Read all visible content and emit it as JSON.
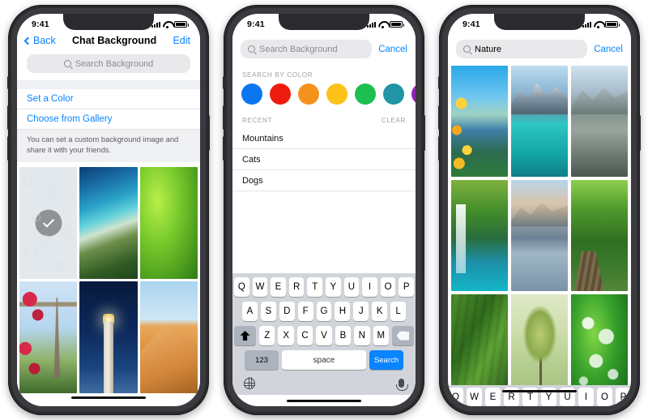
{
  "status_bar": {
    "time": "9:41",
    "icons": [
      "signal-icon",
      "wifi-icon",
      "battery-icon"
    ]
  },
  "phone1": {
    "nav": {
      "back_label": "Back",
      "title": "Chat Background",
      "edit_label": "Edit"
    },
    "search": {
      "placeholder": "Search Background",
      "icon": "search-icon"
    },
    "options": [
      {
        "label": "Set a Color"
      },
      {
        "label": "Choose from Gallery"
      }
    ],
    "footnote": "You can set a custom background image and share it with your friends.",
    "tiles": [
      {
        "name": "doodle-pattern",
        "selected": true,
        "check_icon": "check-icon"
      },
      {
        "name": "tropical-beach",
        "selected": false
      },
      {
        "name": "green-fern-leaf",
        "selected": false
      },
      {
        "name": "eiffel-tower-roses",
        "selected": false
      },
      {
        "name": "lighthouse-night",
        "selected": false
      },
      {
        "name": "sand-dune",
        "selected": false
      }
    ]
  },
  "phone2": {
    "search": {
      "placeholder": "Search Background",
      "value": "",
      "icon": "search-icon"
    },
    "cancel_label": "Cancel",
    "color_section_title": "SEARCH BY COLOR",
    "colors": [
      "#0b76ef",
      "#ee1c0e",
      "#f5921e",
      "#fcc218",
      "#1dbf4f",
      "#2195a5",
      "#8b23b5"
    ],
    "recent_title": "RECENT",
    "clear_label": "CLEAR",
    "recent_items": [
      "Mountains",
      "Cats",
      "Dogs"
    ],
    "keyboard": {
      "row1": [
        "Q",
        "W",
        "E",
        "R",
        "T",
        "Y",
        "U",
        "I",
        "O",
        "P"
      ],
      "row2": [
        "A",
        "S",
        "D",
        "F",
        "G",
        "H",
        "J",
        "K",
        "L"
      ],
      "row3": [
        "Z",
        "X",
        "C",
        "V",
        "B",
        "N",
        "M"
      ],
      "shift_icon": "shift-icon",
      "backspace_icon": "backspace-icon",
      "numbers_label": "123",
      "space_label": "space",
      "action_label": "Search",
      "globe_icon": "globe-icon",
      "mic_icon": "microphone-icon"
    }
  },
  "phone3": {
    "search": {
      "value": "Nature",
      "icon": "search-icon"
    },
    "cancel_label": "Cancel",
    "results": [
      {
        "name": "yellow-flowers-lake"
      },
      {
        "name": "turquoise-mountain-lake"
      },
      {
        "name": "rocky-river-mountains"
      },
      {
        "name": "jungle-waterfall"
      },
      {
        "name": "mountain-reflection-lake"
      },
      {
        "name": "forest-boardwalk-path"
      },
      {
        "name": "mossy-rocks"
      },
      {
        "name": "tree-in-meadow"
      },
      {
        "name": "dewdrops-on-leaf"
      }
    ],
    "partial_keyboard_row": [
      "Q",
      "W",
      "E",
      "R",
      "T",
      "Y",
      "U",
      "I",
      "O",
      "P"
    ]
  }
}
